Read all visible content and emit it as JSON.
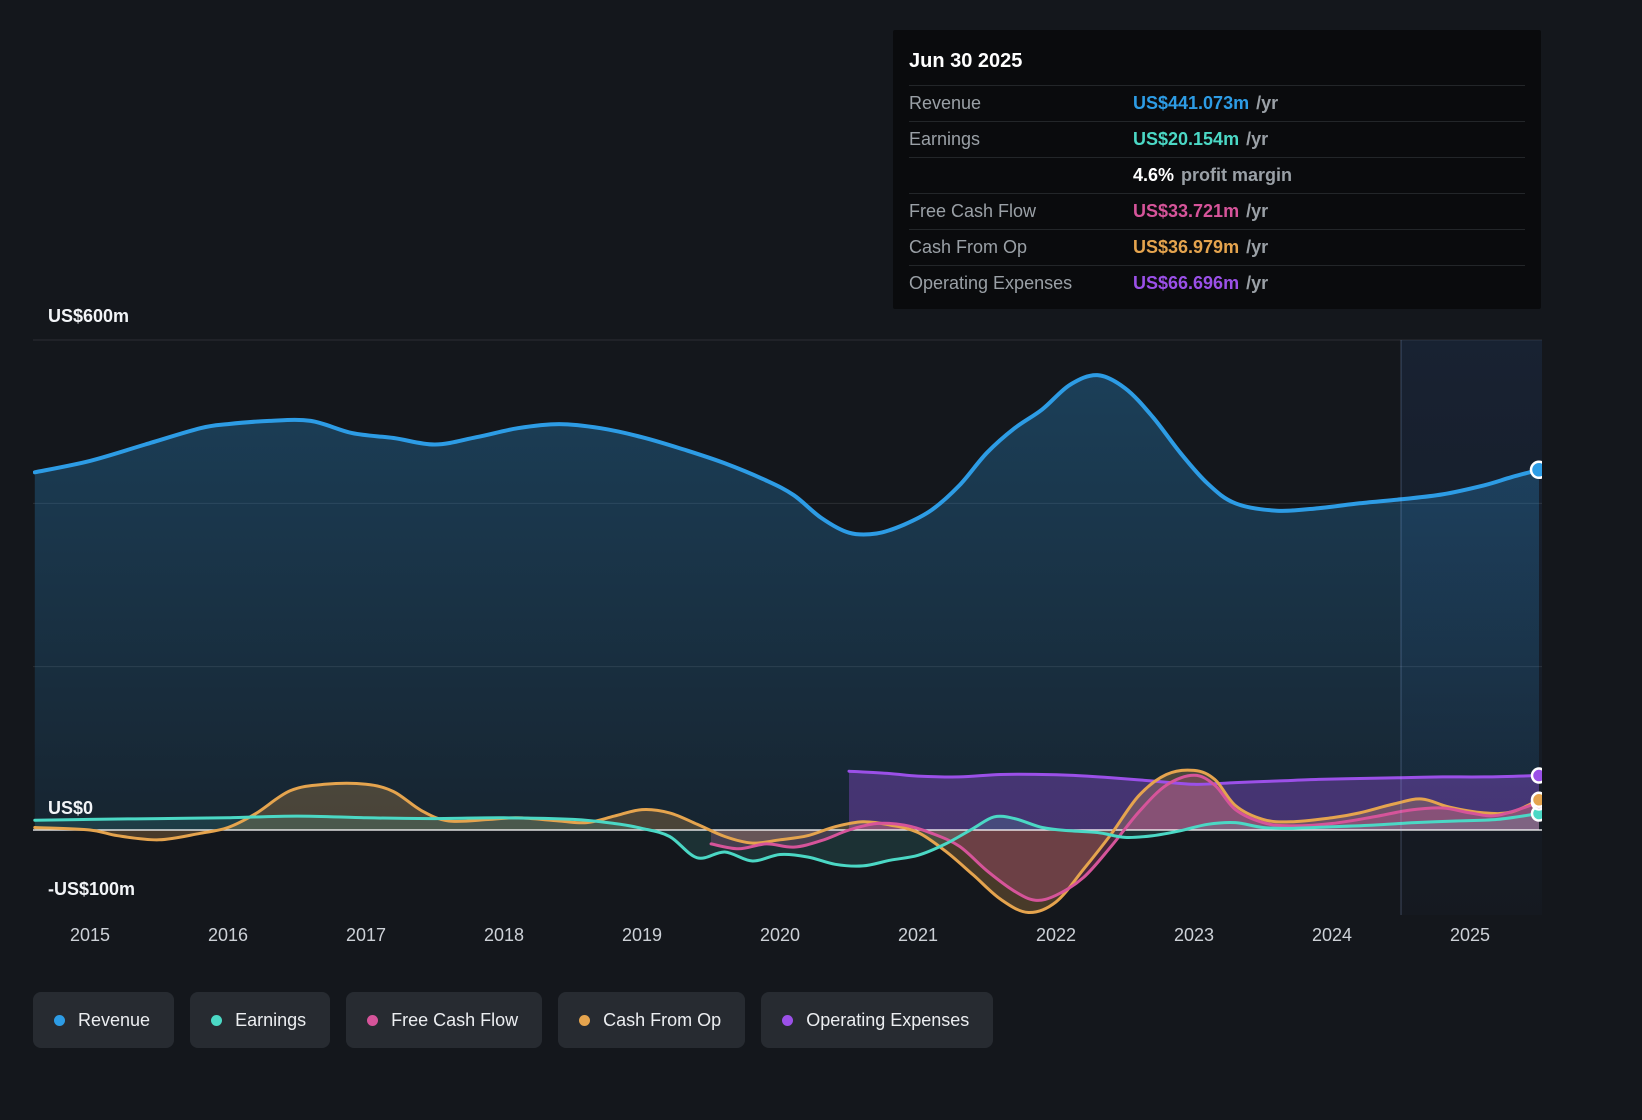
{
  "tooltip": {
    "date": "Jun 30 2025",
    "revenue": {
      "label": "Revenue",
      "value": "US$441.073m",
      "unit": "/yr",
      "color": "#2d9ce5"
    },
    "earnings": {
      "label": "Earnings",
      "value": "US$20.154m",
      "unit": "/yr",
      "color": "#4bd8c5"
    },
    "margin": {
      "strong": "4.6%",
      "text": "profit margin"
    },
    "fcf": {
      "label": "Free Cash Flow",
      "value": "US$33.721m",
      "unit": "/yr",
      "color": "#d6549a"
    },
    "cashop": {
      "label": "Cash From Op",
      "value": "US$36.979m",
      "unit": "/yr",
      "color": "#e5a44e"
    },
    "opex": {
      "label": "Operating Expenses",
      "value": "US$66.696m",
      "unit": "/yr",
      "color": "#9b50e8"
    }
  },
  "legend": {
    "items": [
      {
        "label": "Revenue",
        "color": "#2d9ce5"
      },
      {
        "label": "Earnings",
        "color": "#4bd8c5"
      },
      {
        "label": "Free Cash Flow",
        "color": "#d6549a"
      },
      {
        "label": "Cash From Op",
        "color": "#e5a44e"
      },
      {
        "label": "Operating Expenses",
        "color": "#9b50e8"
      }
    ]
  },
  "chart_data": {
    "type": "area",
    "title": "Earnings and Revenue History (US$ millions per year)",
    "xlabel": "",
    "ylabel": "",
    "ylim": [
      -130,
      620
    ],
    "x_ticks": [
      2015,
      2016,
      2017,
      2018,
      2019,
      2020,
      2021,
      2022,
      2023,
      2024,
      2025
    ],
    "y_axis_labels": [
      {
        "text": "US$600m",
        "value": 600
      },
      {
        "text": "US$0",
        "value": 0
      },
      {
        "text": "-US$100m",
        "value": -100
      }
    ],
    "gridlines": [
      600,
      400,
      200
    ],
    "zero_line": 0,
    "marker_year": 2024.5,
    "legend_position": "bottom",
    "draw_order": [
      0,
      4,
      3,
      2,
      1
    ],
    "series": [
      {
        "name": "Revenue",
        "color": "#2d9ce5",
        "fill_opacity": 0.3,
        "points": [
          [
            2014.6,
            438
          ],
          [
            2015,
            452
          ],
          [
            2015.4,
            472
          ],
          [
            2015.8,
            492
          ],
          [
            2016,
            497
          ],
          [
            2016.3,
            501
          ],
          [
            2016.6,
            501
          ],
          [
            2016.9,
            486
          ],
          [
            2017.2,
            480
          ],
          [
            2017.5,
            472
          ],
          [
            2017.8,
            481
          ],
          [
            2018.1,
            492
          ],
          [
            2018.4,
            497
          ],
          [
            2018.7,
            492
          ],
          [
            2019,
            481
          ],
          [
            2019.3,
            466
          ],
          [
            2019.6,
            449
          ],
          [
            2019.9,
            428
          ],
          [
            2020.1,
            410
          ],
          [
            2020.3,
            382
          ],
          [
            2020.5,
            364
          ],
          [
            2020.7,
            363
          ],
          [
            2020.9,
            374
          ],
          [
            2021.1,
            392
          ],
          [
            2021.3,
            422
          ],
          [
            2021.5,
            462
          ],
          [
            2021.7,
            492
          ],
          [
            2021.9,
            515
          ],
          [
            2022.1,
            545
          ],
          [
            2022.3,
            557
          ],
          [
            2022.5,
            541
          ],
          [
            2022.7,
            506
          ],
          [
            2022.9,
            462
          ],
          [
            2023.1,
            424
          ],
          [
            2023.3,
            400
          ],
          [
            2023.6,
            391
          ],
          [
            2023.9,
            394
          ],
          [
            2024.2,
            400
          ],
          [
            2024.5,
            405
          ],
          [
            2024.8,
            411
          ],
          [
            2025.1,
            422
          ],
          [
            2025.3,
            432
          ],
          [
            2025.5,
            441.073
          ]
        ]
      },
      {
        "name": "Earnings",
        "color": "#4bd8c5",
        "fill_opacity": 0.14,
        "points": [
          [
            2014.6,
            12
          ],
          [
            2015,
            13
          ],
          [
            2015.5,
            14
          ],
          [
            2016,
            15
          ],
          [
            2016.5,
            17
          ],
          [
            2017,
            15
          ],
          [
            2017.5,
            14
          ],
          [
            2018,
            15
          ],
          [
            2018.5,
            13
          ],
          [
            2018.8,
            8
          ],
          [
            2019,
            2
          ],
          [
            2019.2,
            -8
          ],
          [
            2019.4,
            -34
          ],
          [
            2019.6,
            -27
          ],
          [
            2019.8,
            -38
          ],
          [
            2020,
            -30
          ],
          [
            2020.2,
            -33
          ],
          [
            2020.4,
            -42
          ],
          [
            2020.6,
            -44
          ],
          [
            2020.8,
            -37
          ],
          [
            2021,
            -31
          ],
          [
            2021.2,
            -17
          ],
          [
            2021.4,
            2
          ],
          [
            2021.55,
            16
          ],
          [
            2021.7,
            14
          ],
          [
            2021.9,
            3
          ],
          [
            2022.1,
            -1
          ],
          [
            2022.3,
            -3
          ],
          [
            2022.5,
            -9
          ],
          [
            2022.7,
            -7
          ],
          [
            2022.9,
            -1
          ],
          [
            2023.1,
            7
          ],
          [
            2023.3,
            9
          ],
          [
            2023.5,
            3
          ],
          [
            2023.7,
            2
          ],
          [
            2024,
            4
          ],
          [
            2024.3,
            6
          ],
          [
            2024.6,
            9
          ],
          [
            2024.9,
            11
          ],
          [
            2025.2,
            13
          ],
          [
            2025.5,
            20.154
          ]
        ]
      },
      {
        "name": "Free Cash Flow",
        "color": "#d6549a",
        "fill_opacity": 0.25,
        "points": [
          [
            2019.5,
            -17
          ],
          [
            2019.7,
            -23
          ],
          [
            2019.9,
            -17
          ],
          [
            2020.1,
            -21
          ],
          [
            2020.3,
            -13
          ],
          [
            2020.5,
            0
          ],
          [
            2020.7,
            8
          ],
          [
            2020.9,
            6
          ],
          [
            2021.1,
            -4
          ],
          [
            2021.3,
            -20
          ],
          [
            2021.5,
            -50
          ],
          [
            2021.7,
            -75
          ],
          [
            2021.85,
            -86
          ],
          [
            2022,
            -80
          ],
          [
            2022.2,
            -58
          ],
          [
            2022.4,
            -20
          ],
          [
            2022.6,
            22
          ],
          [
            2022.8,
            55
          ],
          [
            2023,
            67
          ],
          [
            2023.15,
            55
          ],
          [
            2023.3,
            25
          ],
          [
            2023.5,
            9
          ],
          [
            2023.7,
            5
          ],
          [
            2024,
            8
          ],
          [
            2024.3,
            16
          ],
          [
            2024.55,
            24
          ],
          [
            2024.8,
            27
          ],
          [
            2025,
            21
          ],
          [
            2025.2,
            18
          ],
          [
            2025.5,
            33.721
          ]
        ]
      },
      {
        "name": "Cash From Op",
        "color": "#e5a44e",
        "fill_opacity": 0.25,
        "points": [
          [
            2014.6,
            3
          ],
          [
            2015,
            0
          ],
          [
            2015.2,
            -7
          ],
          [
            2015.5,
            -12
          ],
          [
            2015.8,
            -4
          ],
          [
            2016,
            3
          ],
          [
            2016.2,
            20
          ],
          [
            2016.45,
            48
          ],
          [
            2016.7,
            56
          ],
          [
            2017,
            56
          ],
          [
            2017.2,
            47
          ],
          [
            2017.4,
            24
          ],
          [
            2017.6,
            11
          ],
          [
            2017.9,
            13
          ],
          [
            2018.1,
            15
          ],
          [
            2018.4,
            11
          ],
          [
            2018.6,
            9
          ],
          [
            2018.8,
            17
          ],
          [
            2019,
            25
          ],
          [
            2019.2,
            21
          ],
          [
            2019.4,
            7
          ],
          [
            2019.6,
            -8
          ],
          [
            2019.8,
            -16
          ],
          [
            2020,
            -12
          ],
          [
            2020.2,
            -7
          ],
          [
            2020.4,
            4
          ],
          [
            2020.6,
            10
          ],
          [
            2020.8,
            6
          ],
          [
            2021,
            -3
          ],
          [
            2021.2,
            -26
          ],
          [
            2021.4,
            -55
          ],
          [
            2021.6,
            -85
          ],
          [
            2021.8,
            -101
          ],
          [
            2022,
            -88
          ],
          [
            2022.2,
            -48
          ],
          [
            2022.4,
            -5
          ],
          [
            2022.6,
            42
          ],
          [
            2022.8,
            68
          ],
          [
            2023,
            73
          ],
          [
            2023.15,
            62
          ],
          [
            2023.3,
            30
          ],
          [
            2023.5,
            13
          ],
          [
            2023.7,
            10
          ],
          [
            2024,
            15
          ],
          [
            2024.2,
            21
          ],
          [
            2024.45,
            32
          ],
          [
            2024.65,
            38
          ],
          [
            2024.85,
            28
          ],
          [
            2025.1,
            21
          ],
          [
            2025.3,
            22
          ],
          [
            2025.5,
            36.979
          ]
        ]
      },
      {
        "name": "Operating Expenses",
        "color": "#9b50e8",
        "fill_opacity": 0.35,
        "points": [
          [
            2020.5,
            72
          ],
          [
            2020.8,
            69
          ],
          [
            2021,
            66
          ],
          [
            2021.3,
            65
          ],
          [
            2021.6,
            68
          ],
          [
            2021.9,
            68
          ],
          [
            2022.1,
            67
          ],
          [
            2022.4,
            64
          ],
          [
            2022.7,
            60
          ],
          [
            2023,
            56
          ],
          [
            2023.3,
            58
          ],
          [
            2023.6,
            60
          ],
          [
            2023.9,
            62
          ],
          [
            2024.2,
            63
          ],
          [
            2024.5,
            64
          ],
          [
            2024.8,
            65
          ],
          [
            2025.1,
            65
          ],
          [
            2025.5,
            66.696
          ]
        ]
      }
    ]
  }
}
